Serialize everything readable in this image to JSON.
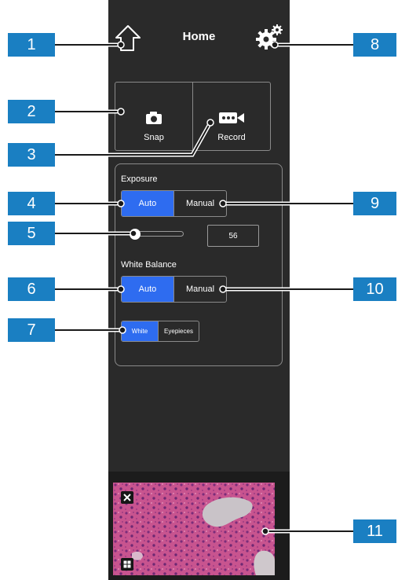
{
  "header": {
    "title": "Home",
    "home_icon": "home-icon",
    "settings_icon": "gear-icon"
  },
  "capture": {
    "snap_label": "Snap",
    "record_label": "Record"
  },
  "exposure": {
    "label": "Exposure",
    "auto_label": "Auto",
    "manual_label": "Manual",
    "mode": "Auto",
    "value": "56",
    "slider_fraction": 0.04
  },
  "white_balance": {
    "label": "White Balance",
    "auto_label": "Auto",
    "manual_label": "Manual",
    "mode": "Auto",
    "white_label": "White",
    "eyepieces_label": "Eyepieces",
    "target": "White"
  },
  "callouts": [
    "1",
    "2",
    "3",
    "4",
    "5",
    "6",
    "7",
    "8",
    "9",
    "10",
    "11"
  ],
  "colors": {
    "panel": "#2a2a2a",
    "accent": "#2e6cf0",
    "callout": "#1a7fc2"
  }
}
